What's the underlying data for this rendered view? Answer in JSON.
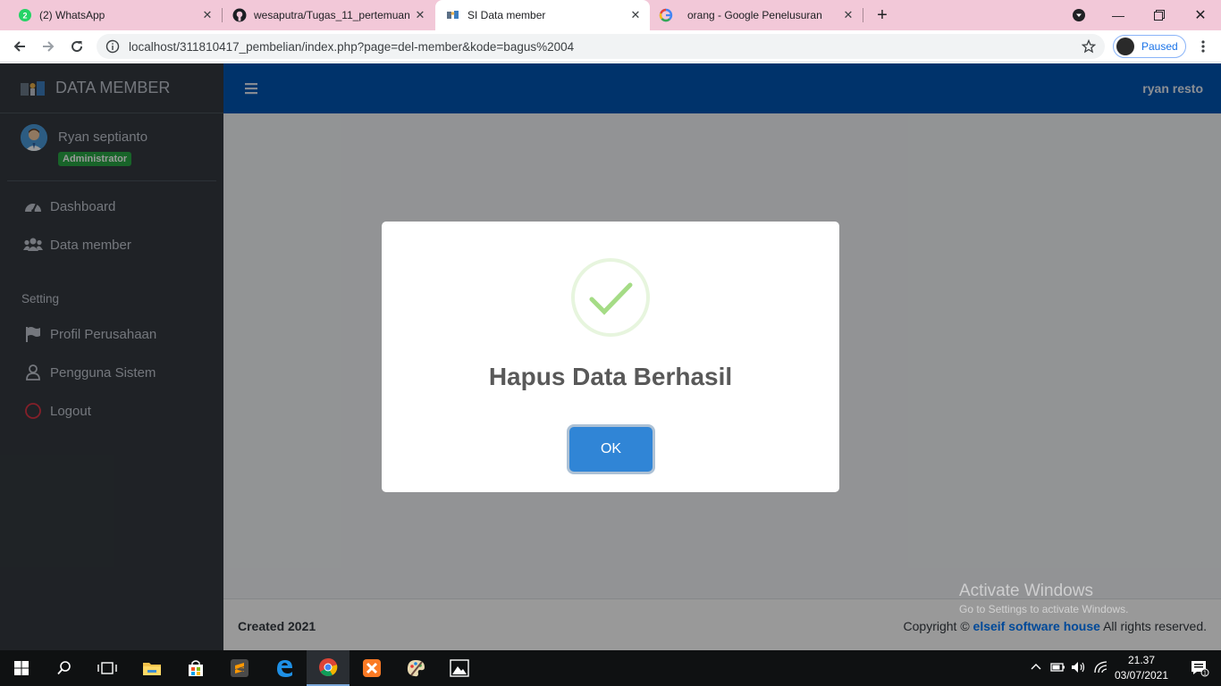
{
  "browser": {
    "tabs": [
      {
        "title": "(2) WhatsApp",
        "icon": "whatsapp-icon"
      },
      {
        "title": "wesaputra/Tugas_11_pertemuan",
        "icon": "github-icon"
      },
      {
        "title": "SI Data member",
        "icon": "page-icon",
        "active": true
      },
      {
        "title": "orang - Google Penelusuran",
        "icon": "google-icon"
      }
    ],
    "url": "localhost/311810417_pembelian/index.php?page=del-member&kode=bagus%2004",
    "profile_status": "Paused"
  },
  "sidebar": {
    "brand": "DATA MEMBER",
    "user_name": "Ryan septianto",
    "user_role": "Administrator",
    "items": [
      {
        "label": "Dashboard",
        "icon": "dashboard-icon"
      },
      {
        "label": "Data member",
        "icon": "users-icon"
      }
    ],
    "section_header": "Setting",
    "setting_items": [
      {
        "label": "Profil Perusahaan",
        "icon": "flag-icon"
      },
      {
        "label": "Pengguna Sistem",
        "icon": "user-icon"
      },
      {
        "label": "Logout",
        "icon": "power-icon"
      }
    ]
  },
  "header": {
    "right_name": "ryan resto"
  },
  "footer": {
    "created": "Created 2021",
    "copyright_prefix": "Copyright ©",
    "company": "elseif software house",
    "copyright_suffix": "All rights reserved."
  },
  "watermark": {
    "line1": "Activate Windows",
    "line2": "Go to Settings to activate Windows."
  },
  "modal": {
    "message": "Hapus Data Berhasil",
    "ok_label": "OK",
    "icon": "success-check-icon"
  },
  "taskbar": {
    "time": "21.37",
    "date": "03/07/2021",
    "notification_count": "1"
  },
  "colors": {
    "sidebar_bg": "#343a40",
    "header_bg": "#0056b3",
    "badge_bg": "#28a745",
    "ok_button": "#3085d6",
    "success": "#a5dc86"
  }
}
